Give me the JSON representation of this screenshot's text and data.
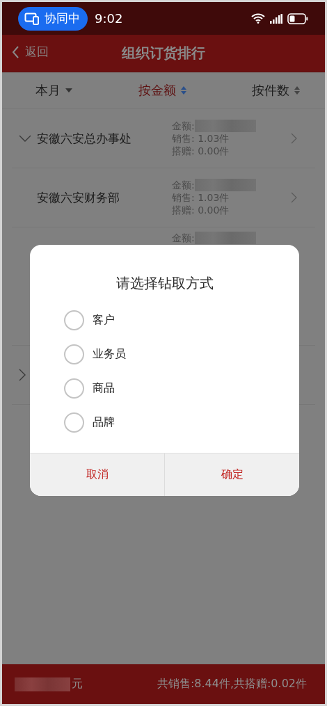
{
  "status_bar": {
    "badge": "协同中",
    "time": "9:02"
  },
  "nav": {
    "back": "返回",
    "title": "组织订货排行"
  },
  "filters": [
    {
      "label": "本月",
      "kind": "dropdown",
      "selected": false
    },
    {
      "label": "按金额",
      "kind": "sort",
      "selected": true
    },
    {
      "label": "按件数",
      "kind": "sort",
      "selected": false
    }
  ],
  "rows": [
    {
      "name": "安徽六安总办事处",
      "expanded": true,
      "amount_label": "金额:",
      "sales": "销售: 1.03件",
      "gift": "搭赠: 0.00件",
      "link": true
    },
    {
      "name": "安徽六安财务部",
      "amount_label": "金额:",
      "sales": "销售: 1.03件",
      "gift": "搭赠: 0.00件",
      "link": true
    },
    {
      "amount_label": "金额:"
    },
    {
      "expanded": false
    }
  ],
  "dialog": {
    "title": "请选择钻取方式",
    "options": [
      {
        "label": "客户",
        "selected": false
      },
      {
        "label": "业务员",
        "selected": false
      },
      {
        "label": "商品",
        "selected": false
      },
      {
        "label": "品牌",
        "selected": false
      }
    ],
    "buttons": [
      "取消",
      "确定"
    ]
  },
  "footer": {
    "amount_unit": "元",
    "totals": "共销售:8.44件,共搭赠:0.02件"
  }
}
